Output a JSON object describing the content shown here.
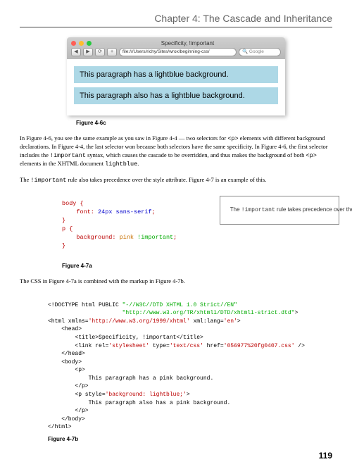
{
  "chapter_title": "Chapter 4: The Cascade and Inheritance",
  "browser": {
    "window_title": "Specificity, !important",
    "nav_back": "◀",
    "nav_fwd": "▶",
    "reload": "⟳",
    "plus": "+",
    "url": "file:///Users/richy/Sites/wrox/beginning-css/",
    "search_placeholder": "Google",
    "para1": "This paragraph has a lightblue background.",
    "para2": "This paragraph also has a lightblue background."
  },
  "fig46c": "Figure 4-6c",
  "body1_pre": "In Figure 4-6, you see the same example as you saw in Figure 4-4 — two selectors for ",
  "body1_code1": "<p>",
  "body1_mid": " elements with different background declarations. In Figure 4-4, the last selector won because both selectors have the same specificity. In Figure 4-6, the first selector includes the ",
  "body1_code2": "!important",
  "body1_mid2": " syntax, which causes the cascade to be overridden, and thus makes the background of both ",
  "body1_code3": "<p>",
  "body1_mid3": " elements in the XHTML document ",
  "body1_code4": "lightblue",
  "body1_end": ".",
  "body2_pre": "The ",
  "body2_code": "!important",
  "body2_post": " rule also takes precedence over the style attribute. Figure 4-7 is an example of this.",
  "css_code": {
    "l1": "body {",
    "l2a": "    font: ",
    "l2b": "24px sans-serif",
    "l2c": ";",
    "l3": "}",
    "l4": "p {",
    "l5a": "    background: ",
    "l5b": "pink",
    "l5c": " !important",
    "l5d": ";",
    "l6": "}"
  },
  "annotation_a": "The ",
  "annotation_code": "!important",
  "annotation_b": " rule takes precedence over the (X)HTML style attribute.",
  "fig47a": "Figure 4-7a",
  "body3": "The CSS in Figure 4-7a is combined with the markup in Figure 4-7b.",
  "markup": {
    "l1a": "<!DOCTYPE html PUBLIC ",
    "l1b": "\"-//W3C//DTD XHTML 1.0 Strict//EN\"",
    "l2": "                      \"http://www.w3.org/TR/xhtml1/DTD/xhtml1-strict.dtd\"",
    "l2c": ">",
    "l3a": "<html xmlns=",
    "l3b": "'http://www.w3.org/1999/xhtml'",
    "l3c": " xml:lang=",
    "l3d": "'en'",
    "l3e": ">",
    "l4": "    <head>",
    "l5": "        <title>Specificity, !important</title>",
    "l6a": "        <link rel=",
    "l6b": "'stylesheet'",
    "l6c": " type=",
    "l6d": "'text/css'",
    "l6e": " href=",
    "l6f": "'056977%20fg0407.css'",
    "l6g": " />",
    "l7": "    </head>",
    "l8": "    <body>",
    "l9": "        <p>",
    "l10": "            This paragraph has a pink background.",
    "l11": "        </p>",
    "l12a": "        <p style=",
    "l12b": "'background: lightblue;'",
    "l12c": ">",
    "l13": "            This paragraph also has a pink background.",
    "l14": "        </p>",
    "l15": "    </body>",
    "l16": "</html>"
  },
  "fig47b": "Figure 4-7b",
  "page_number": "119"
}
